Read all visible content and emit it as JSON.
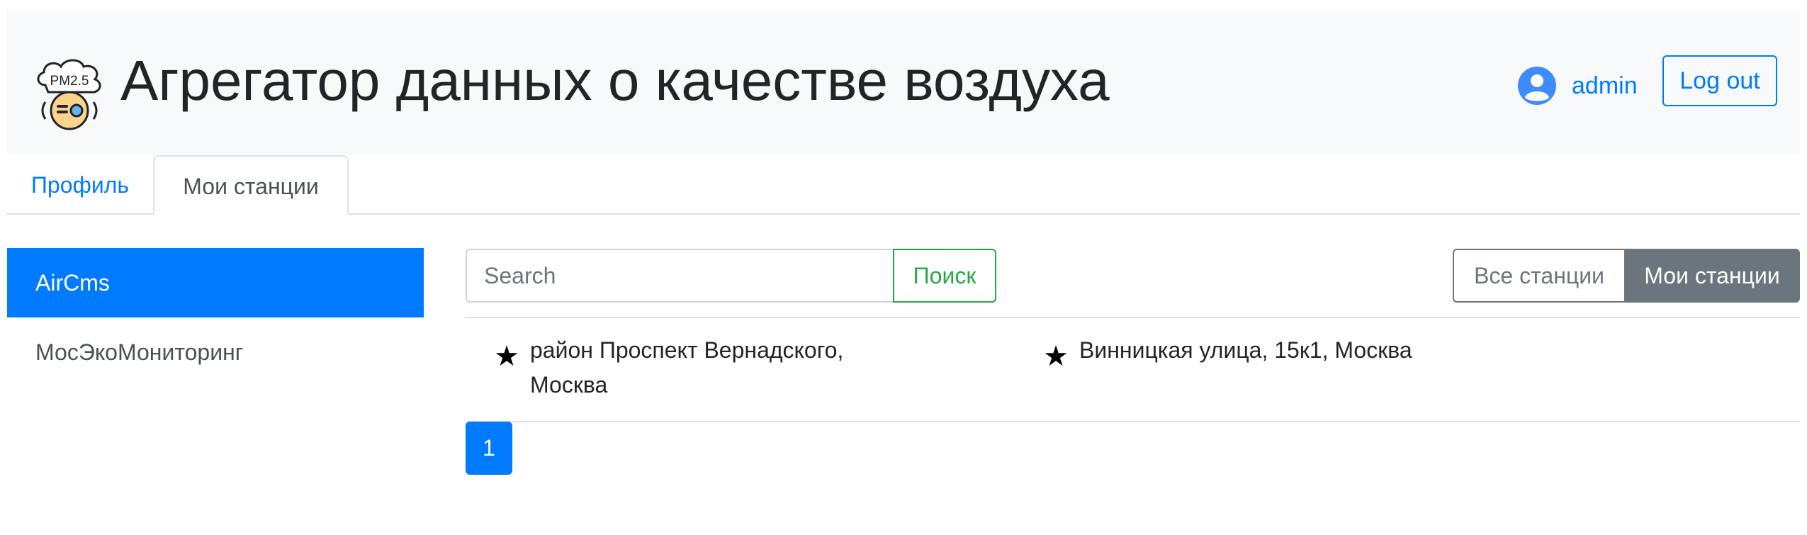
{
  "header": {
    "logo_text": "PM2.5",
    "title": "Агрегатор данных о качестве воздуха",
    "user_name": "admin",
    "logout_label": "Log out"
  },
  "tabs": [
    {
      "label": "Профиль",
      "active": false
    },
    {
      "label": "Мои станции",
      "active": true
    }
  ],
  "sidebar": {
    "items": [
      {
        "label": "AirCms",
        "active": true
      },
      {
        "label": "МосЭкоМониторинг",
        "active": false
      }
    ]
  },
  "search": {
    "placeholder": "Search",
    "button_label": "Поиск"
  },
  "filter": {
    "all_label": "Все станции",
    "mine_label": "Мои станции",
    "selected": "Мои станции"
  },
  "stations": [
    {
      "icon": "star-icon",
      "address": "район Проспект Вернадского, Москва"
    },
    {
      "icon": "star-icon",
      "address": "Винницкая улица, 15к1, Москва"
    }
  ],
  "pagination": {
    "current_page": "1"
  },
  "colors": {
    "primary": "#007bff",
    "success": "#28a745",
    "secondary": "#6c757d",
    "header_bg": "#f8f9fa"
  }
}
